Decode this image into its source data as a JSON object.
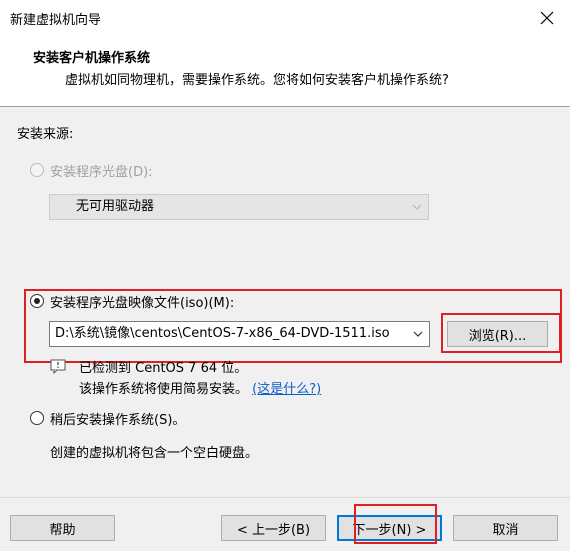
{
  "window": {
    "title": "新建虚拟机向导"
  },
  "header": {
    "title": "安装客户机操作系统",
    "subtitle": "虚拟机如同物理机，需要操作系统。您将如何安装客户机操作系统?"
  },
  "install_source": {
    "label": "安装来源:",
    "option_disc": {
      "label": "安装程序光盘(D):",
      "selected": false,
      "enabled": false
    },
    "disc_drive": {
      "value": "无可用驱动器"
    },
    "option_iso": {
      "label": "安装程序光盘映像文件(iso)(M):",
      "selected": true
    },
    "iso_path": {
      "value": "D:\\系统\\镜像\\centos\\CentOS-7-x86_64-DVD-1511.iso"
    },
    "browse_label": "浏览(R)...",
    "detect_line1": "已检测到 CentOS 7 64 位。",
    "detect_line2": "该操作系统将使用简易安装。",
    "what_is_this": "(这是什么?)",
    "option_later": {
      "label": "稍后安装操作系统(S)。",
      "selected": false
    },
    "later_desc": "创建的虚拟机将包含一个空白硬盘。"
  },
  "footer": {
    "help": "帮助",
    "back": "< 上一步(B)",
    "next": "下一步(N) >",
    "cancel": "取消"
  },
  "colors": {
    "highlight_box": "#e02020",
    "link": "#0b5cc7",
    "accent": "#0078d7"
  }
}
